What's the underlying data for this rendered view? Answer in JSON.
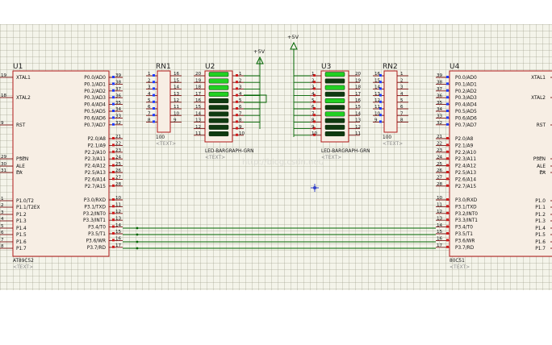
{
  "u1": {
    "ref": "U1",
    "part": "AT89C52",
    "text_tag": "<TEXT>",
    "left_pins": [
      {
        "num": "19",
        "name": "XTAL1"
      },
      {
        "num": "18",
        "name": "XTAL2"
      },
      {
        "num": "9",
        "name": "RST"
      },
      {
        "num": "29",
        "name": "PSEN"
      },
      {
        "num": "30",
        "name": "ALE"
      },
      {
        "num": "31",
        "name": "EA"
      },
      {
        "num": "1",
        "name": "P1.0/T2"
      },
      {
        "num": "2",
        "name": "P1.1/T2EX"
      },
      {
        "num": "3",
        "name": "P1.2"
      },
      {
        "num": "4",
        "name": "P1.3"
      },
      {
        "num": "5",
        "name": "P1.4"
      },
      {
        "num": "6",
        "name": "P1.5"
      },
      {
        "num": "7",
        "name": "P1.6"
      },
      {
        "num": "8",
        "name": "P1.7"
      }
    ],
    "right_pins": [
      {
        "num": "39",
        "name": "P0.0/AD0"
      },
      {
        "num": "38",
        "name": "P0.1/AD1"
      },
      {
        "num": "37",
        "name": "P0.2/AD2"
      },
      {
        "num": "36",
        "name": "P0.3/AD3"
      },
      {
        "num": "35",
        "name": "P0.4/AD4"
      },
      {
        "num": "34",
        "name": "P0.5/AD5"
      },
      {
        "num": "33",
        "name": "P0.6/AD6"
      },
      {
        "num": "32",
        "name": "P0.7/AD7"
      },
      {
        "num": "21",
        "name": "P2.0/A8"
      },
      {
        "num": "22",
        "name": "P2.1/A9"
      },
      {
        "num": "23",
        "name": "P2.2/A10"
      },
      {
        "num": "24",
        "name": "P2.3/A11"
      },
      {
        "num": "25",
        "name": "P2.4/A12"
      },
      {
        "num": "26",
        "name": "P2.5/A13"
      },
      {
        "num": "27",
        "name": "P2.6/A14"
      },
      {
        "num": "28",
        "name": "P2.7/A15"
      },
      {
        "num": "10",
        "name": "P3.0/RXD"
      },
      {
        "num": "11",
        "name": "P3.1/TXD"
      },
      {
        "num": "12",
        "name": "P3.2/INT0"
      },
      {
        "num": "13",
        "name": "P3.3/INT1"
      },
      {
        "num": "14",
        "name": "P3.4/T0"
      },
      {
        "num": "15",
        "name": "P3.5/T1"
      },
      {
        "num": "16",
        "name": "P3.6/WR"
      },
      {
        "num": "17",
        "name": "P3.7/RD"
      }
    ]
  },
  "u4": {
    "ref": "U4",
    "part": "80C51",
    "text_tag": "<TEXT>",
    "left_pins": [
      {
        "num": "39",
        "name": "P0.0/AD0"
      },
      {
        "num": "38",
        "name": "P0.1/AD1"
      },
      {
        "num": "37",
        "name": "P0.2/AD2"
      },
      {
        "num": "36",
        "name": "P0.3/AD3"
      },
      {
        "num": "35",
        "name": "P0.4/AD4"
      },
      {
        "num": "34",
        "name": "P0.5/AD5"
      },
      {
        "num": "33",
        "name": "P0.6/AD6"
      },
      {
        "num": "32",
        "name": "P0.7/AD7"
      },
      {
        "num": "21",
        "name": "P2.0/A8"
      },
      {
        "num": "22",
        "name": "P2.1/A9"
      },
      {
        "num": "23",
        "name": "P2.2/A10"
      },
      {
        "num": "24",
        "name": "P2.3/A11"
      },
      {
        "num": "25",
        "name": "P2.4/A12"
      },
      {
        "num": "26",
        "name": "P2.5/A13"
      },
      {
        "num": "27",
        "name": "P2.6/A14"
      },
      {
        "num": "28",
        "name": "P2.7/A15"
      },
      {
        "num": "10",
        "name": "P3.0/RXD"
      },
      {
        "num": "11",
        "name": "P3.1/TXD"
      },
      {
        "num": "12",
        "name": "P3.2/INT0"
      },
      {
        "num": "13",
        "name": "P3.3/INT1"
      },
      {
        "num": "14",
        "name": "P3.4/T0"
      },
      {
        "num": "15",
        "name": "P3.5/T1"
      },
      {
        "num": "16",
        "name": "P3.6/WR"
      },
      {
        "num": "17",
        "name": "P3.7/RD"
      }
    ],
    "right_pins": [
      {
        "name": "XTAL1"
      },
      {
        "name": "XTAL2"
      },
      {
        "name": "RST"
      },
      {
        "name": "PSEN"
      },
      {
        "name": "ALE"
      },
      {
        "name": "EA"
      },
      {
        "name": "P1.0"
      },
      {
        "name": "P1.1"
      },
      {
        "name": "P1.2"
      },
      {
        "name": "P1.3"
      },
      {
        "name": "P1.4"
      },
      {
        "name": "P1.5"
      },
      {
        "name": "P1.6"
      },
      {
        "name": "P1.7"
      }
    ]
  },
  "rn1": {
    "ref": "RN1",
    "value": "100",
    "text_tag": "<TEXT>",
    "left_nums": [
      "1",
      "2",
      "3",
      "4",
      "5",
      "6",
      "7",
      "8"
    ],
    "right_nums": [
      "16",
      "15",
      "14",
      "13",
      "12",
      "11",
      "10",
      "9"
    ]
  },
  "rn2": {
    "ref": "RN2",
    "value": "100",
    "text_tag": "<TEXT>",
    "left_nums": [
      "16",
      "15",
      "14",
      "13",
      "12",
      "11",
      "10",
      "9"
    ],
    "right_nums": [
      "1",
      "2",
      "3",
      "4",
      "5",
      "6",
      "7",
      "8"
    ]
  },
  "u2": {
    "ref": "U2",
    "part": "LED-BARGRAPH-GRN",
    "text_tag": "<TEXT>",
    "left_nums": [
      "20",
      "19",
      "18",
      "17",
      "16",
      "15",
      "14",
      "13",
      "12",
      "11"
    ],
    "right_nums": [
      "1",
      "2",
      "3",
      "4",
      "5",
      "6",
      "7",
      "8",
      "9",
      "10"
    ],
    "segments_lit": [
      true,
      true,
      true,
      true,
      false,
      false,
      false,
      false,
      false,
      false
    ]
  },
  "u3": {
    "ref": "U3",
    "part": "LED-BARGRAPH-GRN",
    "text_tag": "<TEXT>",
    "left_nums": [
      "1",
      "2",
      "3",
      "4",
      "5",
      "6",
      "7",
      "8",
      "9",
      "10"
    ],
    "right_nums": [
      "20",
      "19",
      "18",
      "17",
      "16",
      "15",
      "14",
      "13",
      "12",
      "11"
    ],
    "segments_lit": [
      true,
      false,
      true,
      false,
      true,
      false,
      true,
      false,
      false,
      false
    ]
  },
  "power": {
    "left_label": "+5V",
    "right_label": "+5V"
  },
  "watermark": "http://blog.csdn.net/"
}
